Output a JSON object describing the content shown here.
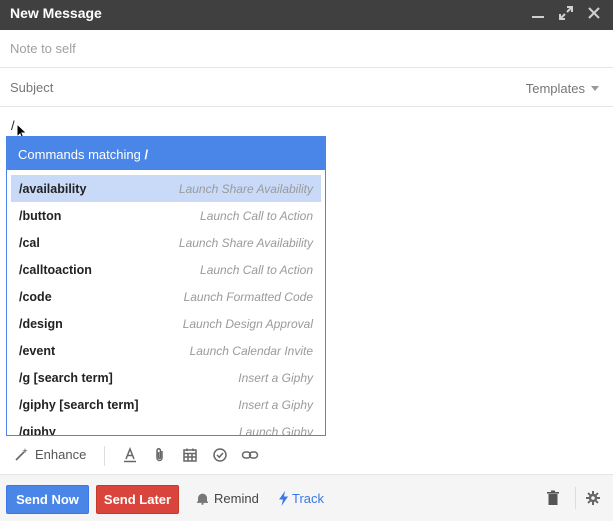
{
  "window": {
    "title": "New Message",
    "controls": [
      "minimize-icon",
      "expand-icon",
      "close-icon"
    ]
  },
  "to_field": {
    "placeholder": "Note to self"
  },
  "subject_field": {
    "placeholder": "Subject"
  },
  "templates_label": "Templates",
  "body": {
    "typed_text": "/"
  },
  "command_popup": {
    "header_prefix": "Commands matching",
    "query": "/",
    "accent_color": "#4a86e8",
    "selected_color": "#c9daf8",
    "selected_index": 0,
    "items": [
      {
        "command": "/availability",
        "description": "Launch Share Availability"
      },
      {
        "command": "/button",
        "description": "Launch Call to Action"
      },
      {
        "command": "/cal",
        "description": "Launch Share Availability"
      },
      {
        "command": "/calltoaction",
        "description": "Launch Call to Action"
      },
      {
        "command": "/code",
        "description": "Launch Formatted Code"
      },
      {
        "command": "/design",
        "description": "Launch Design Approval"
      },
      {
        "command": "/event",
        "description": "Launch Calendar Invite"
      },
      {
        "command": "/g [search term]",
        "description": "Insert a Giphy"
      },
      {
        "command": "/giphy [search term]",
        "description": "Insert a Giphy"
      },
      {
        "command": "/giphy",
        "description": "Launch Giphy"
      }
    ]
  },
  "format_bar": {
    "enhance_label": "Enhance",
    "icons": [
      "text-format-icon",
      "attach-icon",
      "calendar-icon",
      "checkmark-icon",
      "link-icon"
    ]
  },
  "actions": {
    "send_now": "Send Now",
    "send_later": "Send Later",
    "remind": "Remind",
    "track": "Track",
    "send_now_color": "#4a86e8",
    "send_later_color": "#d9453c"
  }
}
